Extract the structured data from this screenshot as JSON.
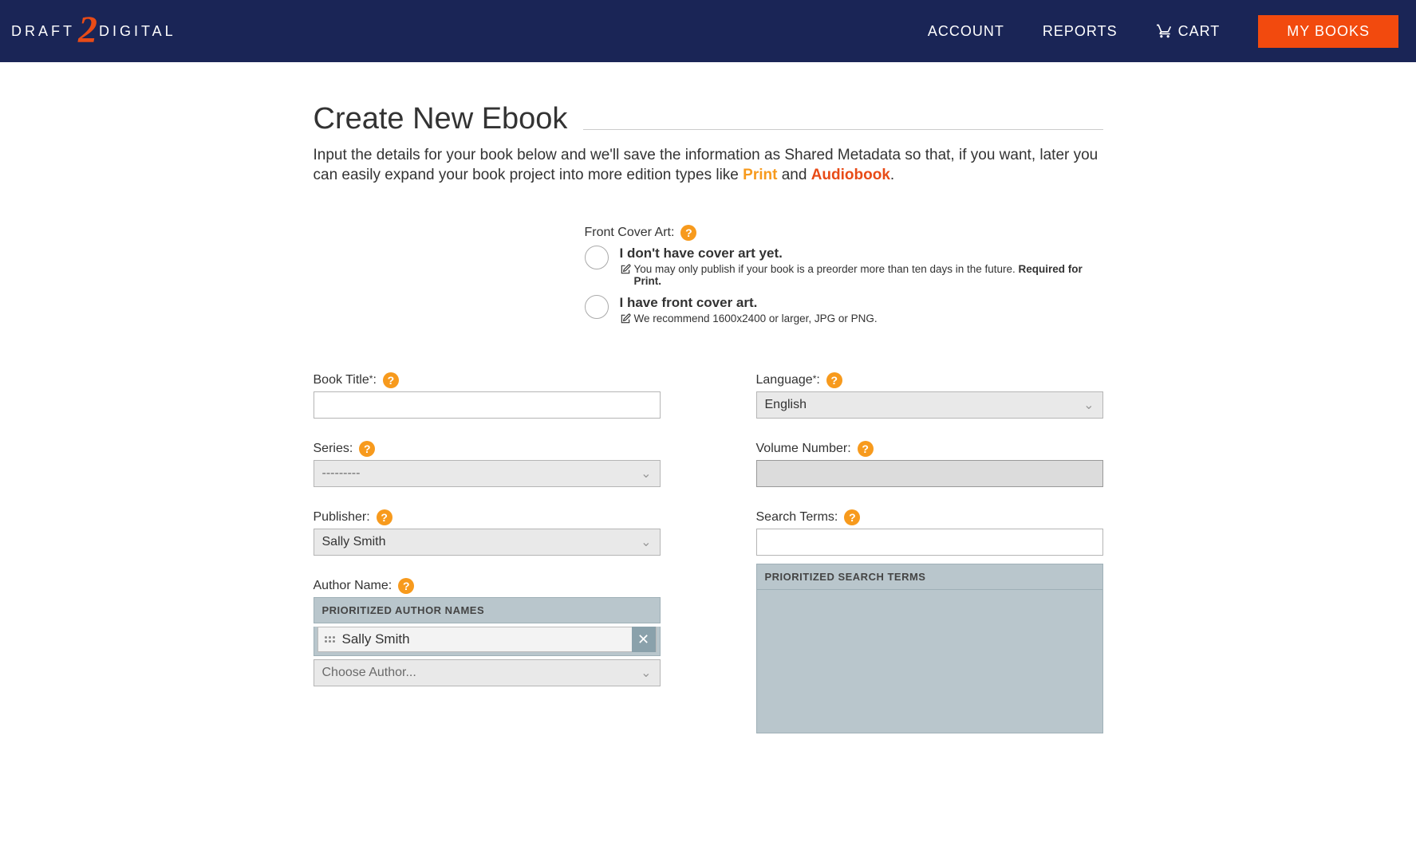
{
  "header": {
    "logo_left": "DRAFT",
    "logo_right": "DIGITAL",
    "nav": {
      "account": "ACCOUNT",
      "reports": "REPORTS",
      "cart": "CART",
      "mybooks": "MY BOOKS"
    }
  },
  "page": {
    "title": "Create New Ebook",
    "intro_a": "Input the details for your book below and we'll save the information as Shared Metadata so that, if you want, later you can easily expand your book project into more edition types like ",
    "intro_print": "Print",
    "intro_and": " and ",
    "intro_audio": "Audiobook",
    "intro_end": "."
  },
  "cover": {
    "label": "Front Cover Art:",
    "opt1_title": "I don't have cover art yet.",
    "opt1_sub_a": "You may only publish if your book is a preorder more than ten days in the future. ",
    "opt1_sub_b": "Required for Print.",
    "opt2_title": "I have front cover art.",
    "opt2_sub": "We recommend 1600x2400 or larger, JPG or PNG."
  },
  "form": {
    "book_title_label": "Book Title",
    "series_label": "Series:",
    "series_value": "---------",
    "publisher_label": "Publisher:",
    "publisher_value": "Sally Smith",
    "author_label": "Author Name:",
    "author_panel_header": "PRIORITIZED AUTHOR NAMES",
    "author_tag": "Sally Smith",
    "choose_author": "Choose Author...",
    "language_label": "Language",
    "language_value": "English",
    "volume_label": "Volume Number:",
    "search_label": "Search Terms:",
    "search_panel_header": "PRIORITIZED SEARCH TERMS"
  }
}
